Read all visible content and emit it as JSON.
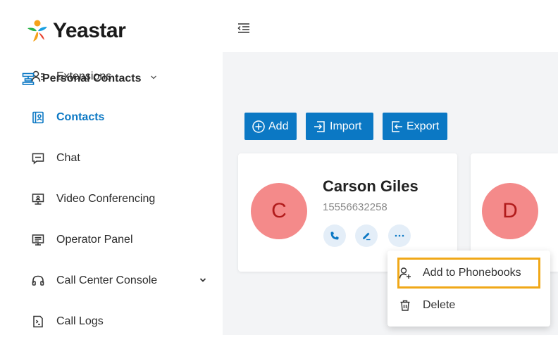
{
  "app": {
    "logo_text": "Yeastar"
  },
  "sidebar": {
    "items": [
      {
        "label": "Extensions",
        "icon": "user-list-icon",
        "active": false
      },
      {
        "label": "Contacts",
        "icon": "contacts-book-icon",
        "active": true
      },
      {
        "label": "Chat",
        "icon": "chat-icon",
        "active": false
      },
      {
        "label": "Video Conferencing",
        "icon": "video-monitor-icon",
        "active": false
      },
      {
        "label": "Operator Panel",
        "icon": "operator-panel-icon",
        "active": false
      },
      {
        "label": "Call Center Console",
        "icon": "headset-icon",
        "active": false,
        "expandable": true
      },
      {
        "label": "Call Logs",
        "icon": "call-logs-icon",
        "active": false
      }
    ]
  },
  "main": {
    "phonebook_selector": "Personal Contacts",
    "toolbar": {
      "add_label": "Add",
      "import_label": "Import",
      "export_label": "Export"
    },
    "contacts": [
      {
        "initial": "C",
        "name": "Carson Giles",
        "number": "15556632258"
      },
      {
        "initial": "D"
      }
    ]
  },
  "context_menu": {
    "items": [
      {
        "label": "Add to Phonebooks",
        "icon": "add-user-icon",
        "highlighted": true
      },
      {
        "label": "Delete",
        "icon": "trash-icon"
      }
    ]
  },
  "colors": {
    "accent": "#0b78c4",
    "avatar_bg": "#f48a8a",
    "avatar_text": "#b11b1b",
    "highlight_border": "#f0a818"
  }
}
